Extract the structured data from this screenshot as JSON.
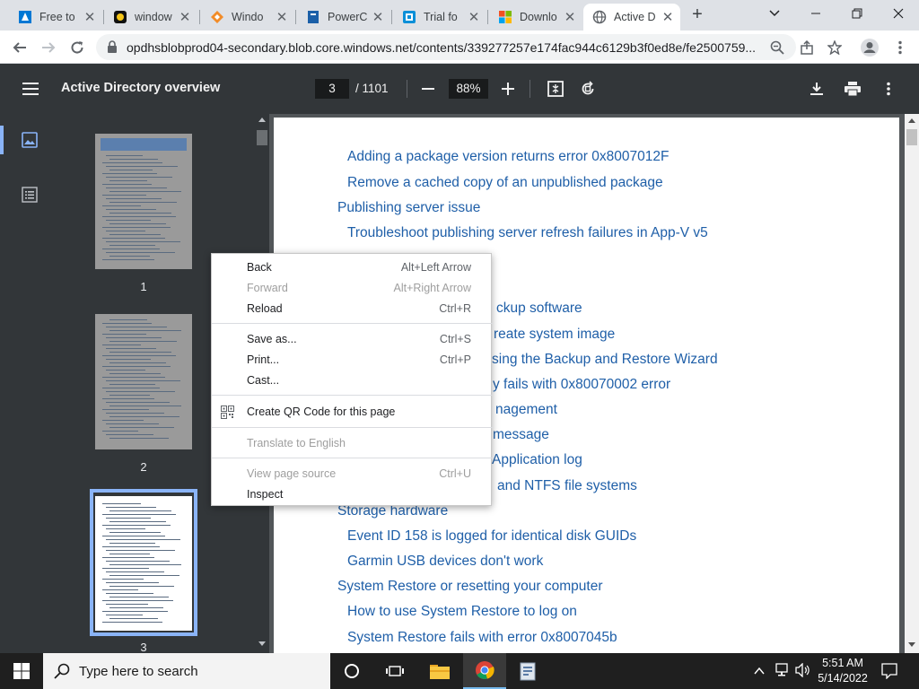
{
  "tabs": [
    {
      "title": "Free to",
      "icon": "azure-icon",
      "color": "#0078d4"
    },
    {
      "title": "window",
      "icon": "brand-icon",
      "color": "#f5c518"
    },
    {
      "title": "Windo",
      "icon": "diamond-icon",
      "color": "#f28c28"
    },
    {
      "title": "PowerC",
      "icon": "book-icon",
      "color": "#1b5fa8"
    },
    {
      "title": "Trial fo",
      "icon": "square-icon",
      "color": "#0a8fd8"
    },
    {
      "title": "Downlo",
      "icon": "microsoft-icon",
      "color": "#f25022"
    },
    {
      "title": "Active D",
      "icon": "globe-icon",
      "color": "#5f6368"
    }
  ],
  "address": {
    "url": "opdhsblobprod04-secondary.blob.core.windows.net/contents/339277257e174fac944c6129b3f0ed8e/fe2500759..."
  },
  "pdf": {
    "title": "Active Directory overview",
    "page": "3",
    "total": "/ 1101",
    "zoom": "88%"
  },
  "thumbnails": [
    {
      "number": "1"
    },
    {
      "number": "2"
    },
    {
      "number": "3"
    }
  ],
  "toc": [
    {
      "text": "Adding a package version returns error 0x8007012F",
      "level": 2
    },
    {
      "text": "Remove a cached copy of an unpublished package",
      "level": 2
    },
    {
      "text": "Publishing server issue",
      "level": 1
    },
    {
      "text": "Troubleshoot publishing server refresh failures in App-V v5",
      "level": 2
    },
    {
      "text": "",
      "level": 2
    },
    {
      "text": "ckup software",
      "level": 2
    },
    {
      "text": "reate system image",
      "level": 2
    },
    {
      "text": "sing the Backup and Restore Wizard",
      "level": 2
    },
    {
      "text": "y fails with 0x80070002 error",
      "level": 2
    },
    {
      "text": "nagement",
      "level": 2
    },
    {
      "text": "message",
      "level": 2
    },
    {
      "text": "Application log",
      "level": 2
    },
    {
      "text": "and NTFS file systems",
      "level": 2
    },
    {
      "text": "Storage hardware",
      "level": 1
    },
    {
      "text": "Event ID 158 is logged for identical disk GUIDs",
      "level": 2
    },
    {
      "text": "Garmin USB devices don't work",
      "level": 2
    },
    {
      "text": "System Restore or resetting your computer",
      "level": 1
    },
    {
      "text": "How to use System Restore to log on",
      "level": 2
    },
    {
      "text": "System Restore fails with error 0x8007045b",
      "level": 2
    }
  ],
  "context_menu": {
    "items": [
      {
        "label": "Back",
        "shortcut": "Alt+Left Arrow",
        "disabled": false
      },
      {
        "label": "Forward",
        "shortcut": "Alt+Right Arrow",
        "disabled": true
      },
      {
        "label": "Reload",
        "shortcut": "Ctrl+R",
        "disabled": false
      },
      {
        "label": "Save as...",
        "shortcut": "Ctrl+S",
        "disabled": false
      },
      {
        "label": "Print...",
        "shortcut": "Ctrl+P",
        "disabled": false
      },
      {
        "label": "Cast...",
        "shortcut": "",
        "disabled": false
      },
      {
        "label": "Create QR Code for this page",
        "shortcut": "",
        "disabled": false,
        "icon": "qr-code-icon"
      },
      {
        "label": "Translate to English",
        "shortcut": "",
        "disabled": true
      },
      {
        "label": "View page source",
        "shortcut": "Ctrl+U",
        "disabled": true
      },
      {
        "label": "Inspect",
        "shortcut": "",
        "disabled": false
      }
    ]
  },
  "taskbar": {
    "search_placeholder": "Type here to search",
    "time": "5:51 AM",
    "date": "5/14/2022"
  }
}
